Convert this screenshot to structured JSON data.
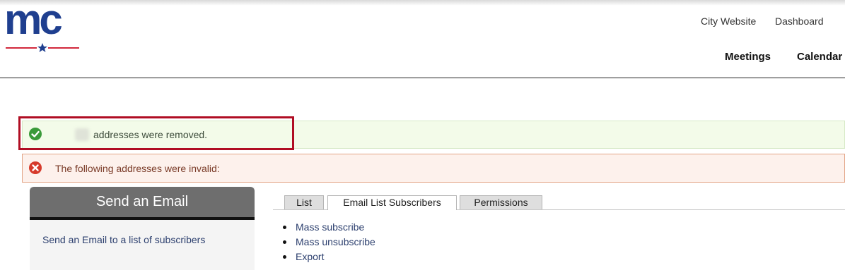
{
  "logo": {
    "text": "mc"
  },
  "header": {
    "util_links": [
      "City Website",
      "Dashboard"
    ],
    "main_nav": [
      "Meetings",
      "Calendar"
    ]
  },
  "alerts": {
    "success": "addresses were removed.",
    "error": "The following addresses were invalid:"
  },
  "sidebar": {
    "title": "Send an Email",
    "link": "Send an Email to a list of subscribers"
  },
  "tabs": [
    {
      "label": "List",
      "active": false
    },
    {
      "label": "Email List Subscribers",
      "active": true
    },
    {
      "label": "Permissions",
      "active": false
    }
  ],
  "actions": [
    "Mass subscribe",
    "Mass unsubscribe",
    "Export"
  ],
  "colors": {
    "brand_blue": "#1f3f8f",
    "brand_red": "#d2283c",
    "success_bg": "#f3fbe9",
    "error_bg": "#fdf1ec",
    "highlight": "#b00d23"
  }
}
